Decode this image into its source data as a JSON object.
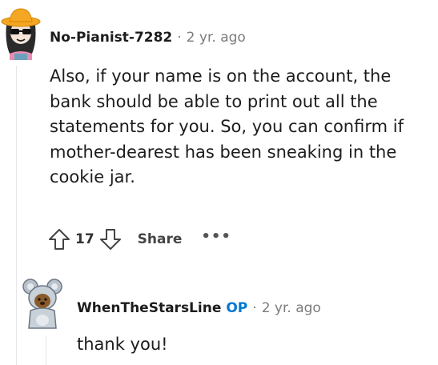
{
  "comment": {
    "username": "No-Pianist-7282",
    "separator": "·",
    "time": "2 yr. ago",
    "body": "Also, if your name is on the account, the bank should be able to print out all the statements for you. So, you can confirm if mother-dearest has been sneaking in the cookie jar.",
    "score": "17",
    "share_label": "Share",
    "more_label": "•••"
  },
  "reply": {
    "username": "WhenTheStarsLine",
    "op_badge": "OP",
    "separator": "·",
    "time": "2 yr. ago",
    "body": "thank you!"
  },
  "colors": {
    "op_badge": "#0079d3",
    "meta_text": "#7c7c7c",
    "thread_line": "#e4e6e8",
    "hat": "#f5a623"
  },
  "icons": {
    "upvote": "upvote-arrow-icon",
    "downvote": "downvote-arrow-icon",
    "more": "more-options-icon"
  }
}
